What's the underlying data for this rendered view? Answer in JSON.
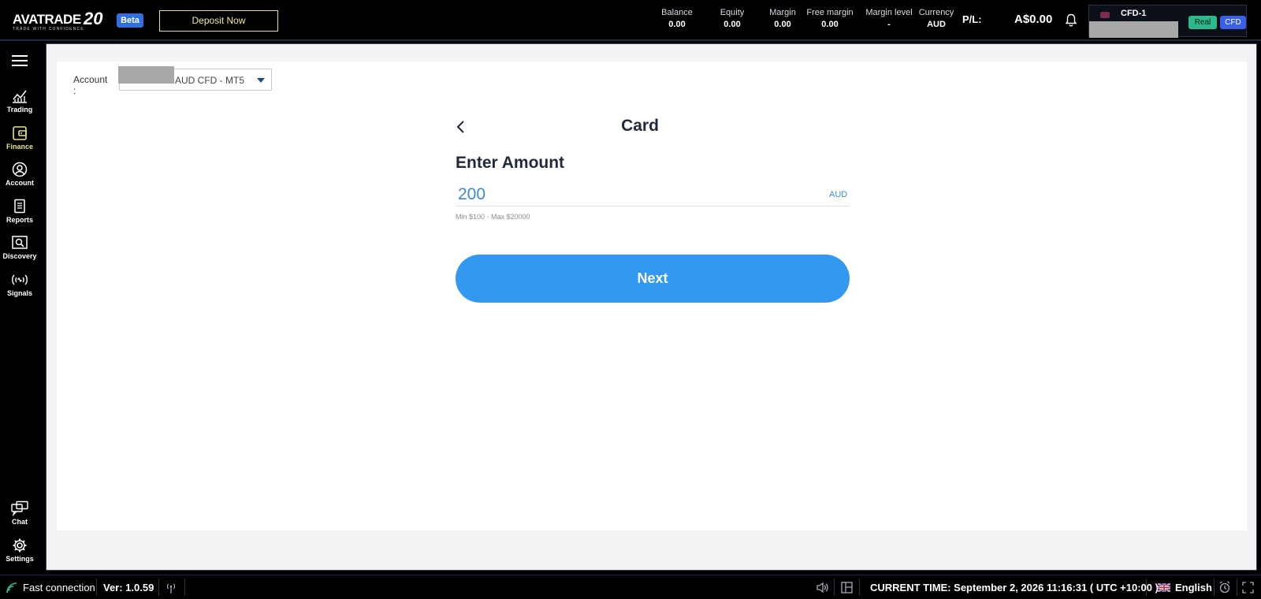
{
  "header": {
    "logo_text": "AVATRADE",
    "logo_twenty": "20",
    "logo_tagline": "TRADE WITH CONFIDENCE",
    "beta_label": "Beta",
    "deposit_label": "Deposit Now",
    "stats": [
      {
        "label": "Balance",
        "value": "0.00"
      },
      {
        "label": "Equity",
        "value": "0.00"
      },
      {
        "label": "Margin",
        "value": "0.00"
      },
      {
        "label": "Free margin",
        "value": "0.00"
      },
      {
        "label": "Margin level",
        "value": "-"
      },
      {
        "label": "Currency",
        "value": "AUD"
      }
    ],
    "pl_label": "P/L:",
    "pl_value": "A$0.00",
    "account_name": "CFD-1",
    "real_label": "Real",
    "cfd_label": "CFD"
  },
  "sidebar": {
    "items": [
      {
        "label": "Trading",
        "icon": "chart-line-icon"
      },
      {
        "label": "Finance",
        "icon": "wallet-icon",
        "active": true
      },
      {
        "label": "Account",
        "icon": "user-circle-icon"
      },
      {
        "label": "Reports",
        "icon": "document-icon"
      },
      {
        "label": "Discovery",
        "icon": "magnify-screen-icon"
      },
      {
        "label": "Signals",
        "icon": "signal-waves-icon"
      }
    ],
    "bottom_items": [
      {
        "label": "Chat",
        "icon": "chat-bubbles-icon"
      },
      {
        "label": "Settings",
        "icon": "gear-icon"
      }
    ]
  },
  "main": {
    "account_label": "Account :",
    "account_select_value": "AUD CFD - MT5",
    "page_title": "Card",
    "amount_label": "Enter Amount",
    "amount_value": "200",
    "amount_currency": "AUD",
    "amount_limits": "Min $100 - Max $20000",
    "next_label": "Next"
  },
  "footer": {
    "connection": "Fast connection",
    "version": "Ver: 1.0.59",
    "current_time": "CURRENT TIME: September 2, 2026 11:16:31 ( UTC +10:00 )",
    "language": "English"
  },
  "colors": {
    "accent_blue": "#3398ef",
    "active_nav": "#e6e38a",
    "real_badge": "#2fb88a",
    "cfd_badge": "#3a5ee6"
  }
}
